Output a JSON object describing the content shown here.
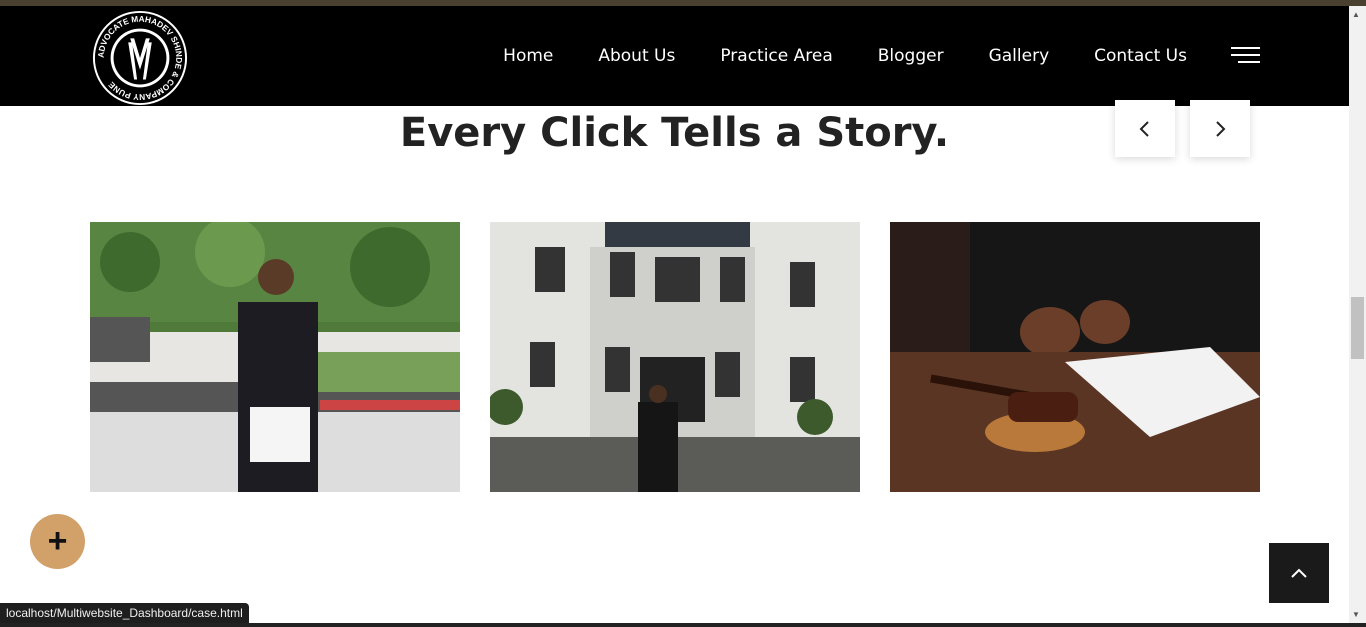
{
  "nav": {
    "logo_text": "ADVOCATE MAHADEV SHINDE & COMPANY PUNE",
    "items": [
      "Home",
      "About Us",
      "Practice Area",
      "Blogger",
      "Gallery",
      "Contact Us"
    ]
  },
  "gallery": {
    "heading": "Every Click Tells a Story.",
    "prev_label": "‹",
    "next_label": "›"
  },
  "status": {
    "url": "localhost/Multiwebsite_Dashboard/case.html"
  },
  "fab": {
    "label": "+"
  },
  "colors": {
    "accent": "#d2a069",
    "nav_bg": "#000000"
  }
}
